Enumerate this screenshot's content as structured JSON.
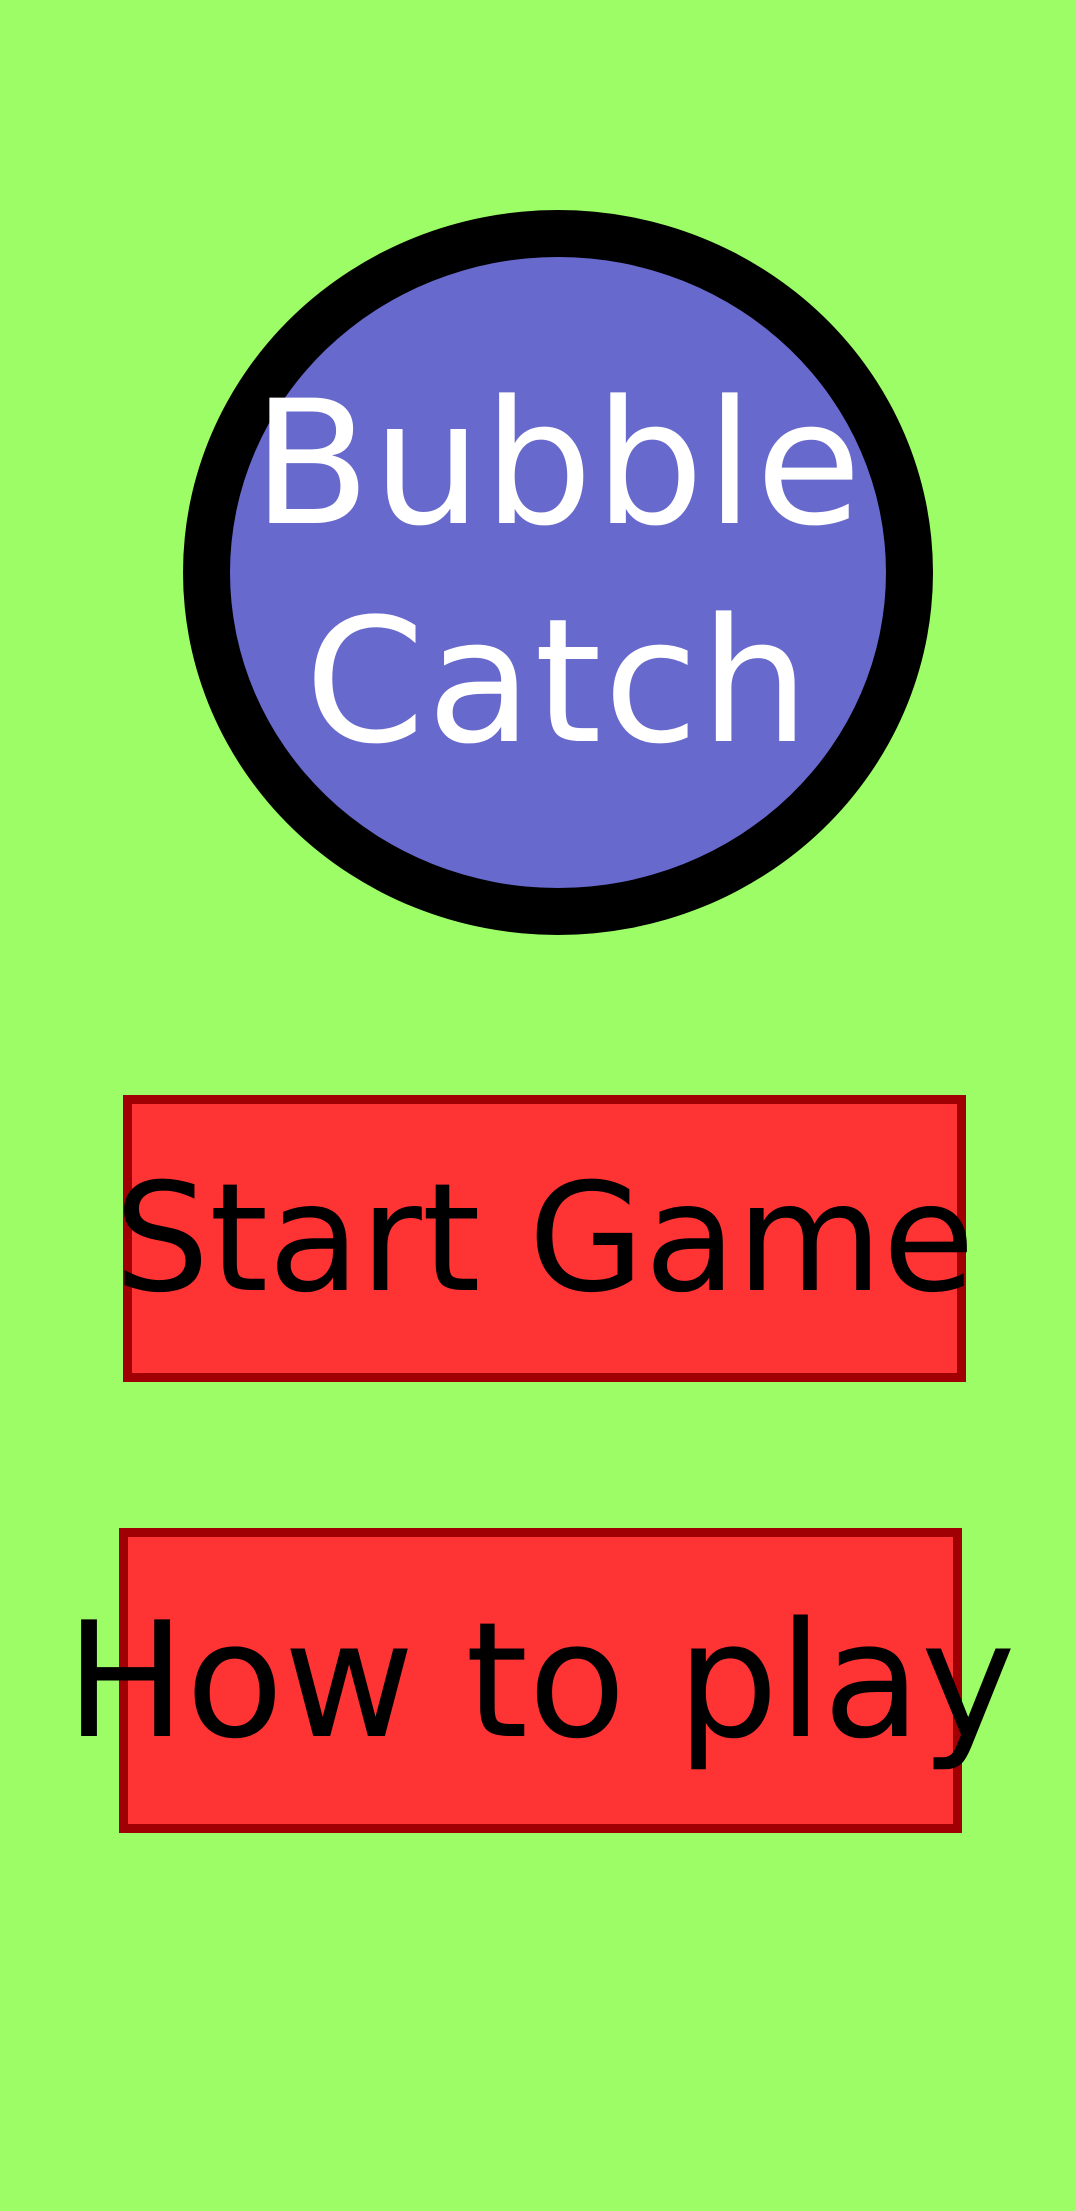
{
  "logo": {
    "title_line1": "Bubble",
    "title_line2": "Catch"
  },
  "menu": {
    "start_label": "Start Game",
    "howto_label": "How to play"
  },
  "colors": {
    "background": "#9cfd66",
    "bubble_fill": "#6869cd",
    "bubble_outline": "#000000",
    "title_text": "#ffffff",
    "button_fill": "#fe3334",
    "button_border": "#a00004",
    "button_text": "#000000"
  }
}
